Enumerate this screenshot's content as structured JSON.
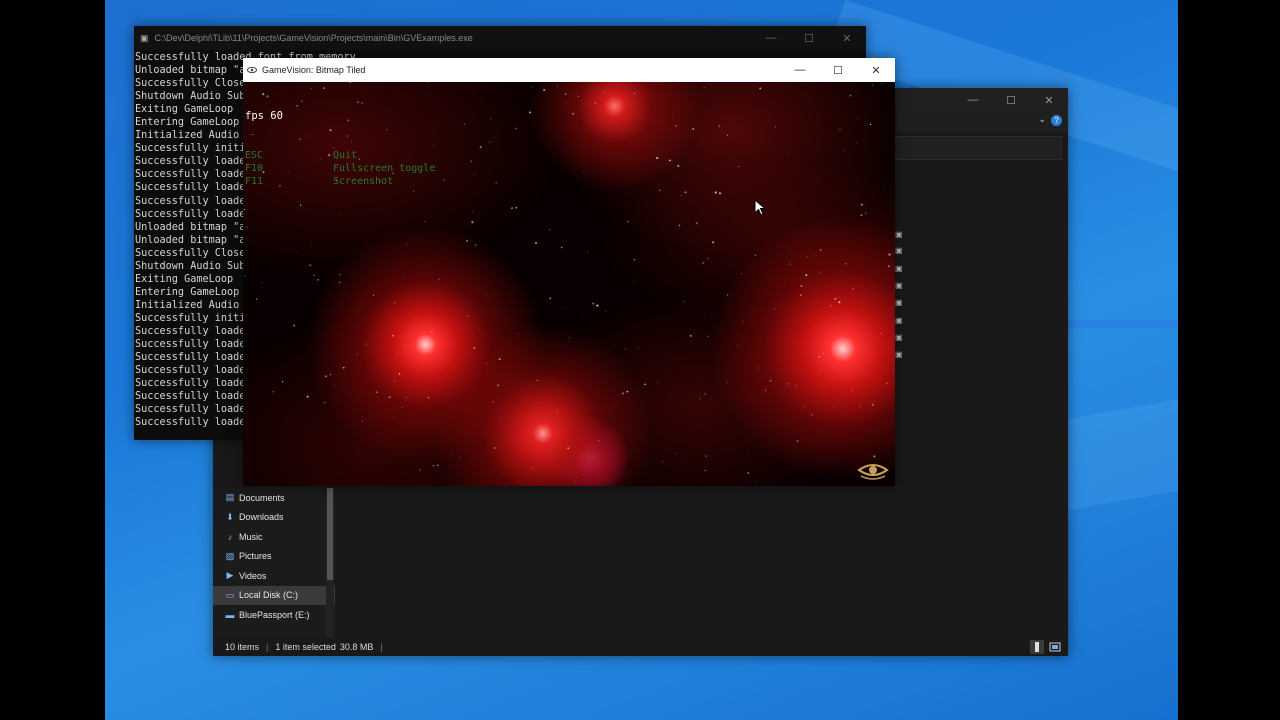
{
  "console": {
    "title": "C:\\Dev\\Delphi\\TLib\\11\\Projects\\GameVision\\Projects\\main\\Bin\\GVExamples.exe",
    "lines": [
      "Successfully loaded font from memory",
      "Unloaded bitmap \"a",
      "Successfully Closed",
      "Shutdown Audio Sub",
      "Exiting GameLoop",
      "Entering GameLoop",
      "Initialized Audio",
      "Successfully initi",
      "Successfully loade",
      "Successfully loade",
      "Successfully loade",
      "Successfully loade",
      "Successfully loade",
      "Unloaded bitmap \"a",
      "Unloaded bitmap \"a",
      "Successfully Closed",
      "Shutdown Audio Sub",
      "Exiting GameLoop",
      "Entering GameLoop",
      "Initialized Audio",
      "Successfully initi",
      "Successfully loade",
      "Successfully loade",
      "Successfully loade",
      "Successfully loade",
      "Successfully loade",
      "Successfully loade",
      "Successfully loade",
      "Successfully loade"
    ],
    "controls": {
      "minimize": "—",
      "maximize": "☐",
      "close": "✕"
    }
  },
  "game": {
    "title": "GameVision: Bitmap Tiled",
    "fps_label": "fps 60",
    "help": [
      {
        "key": "ESC",
        "action": "Quit"
      },
      {
        "key": "F10",
        "action": "Fullscreen toggle"
      },
      {
        "key": "F11",
        "action": "Screenshot"
      }
    ],
    "controls": {
      "minimize": "—",
      "maximize": "☐",
      "close": "✕"
    }
  },
  "explorer": {
    "controls": {
      "minimize": "—",
      "maximize": "☐",
      "close": "✕"
    },
    "nav_items": [
      {
        "label": "Documents",
        "icon": "documents-icon"
      },
      {
        "label": "Downloads",
        "icon": "downloads-icon"
      },
      {
        "label": "Music",
        "icon": "music-icon"
      },
      {
        "label": "Pictures",
        "icon": "pictures-icon"
      },
      {
        "label": "Videos",
        "icon": "videos-icon"
      },
      {
        "label": "Local Disk (C:)",
        "icon": "drive-icon"
      },
      {
        "label": "BluePassport (E:)",
        "icon": "usb-drive-icon"
      }
    ],
    "status": {
      "items": "10 items",
      "selected": "1 item selected",
      "size": "30.8 MB"
    }
  },
  "colors": {
    "desktop_blue": "#1a78d8",
    "console_bg": "#0c0c0c",
    "explorer_bg": "#191919",
    "help_green": "#2e8a2e"
  }
}
